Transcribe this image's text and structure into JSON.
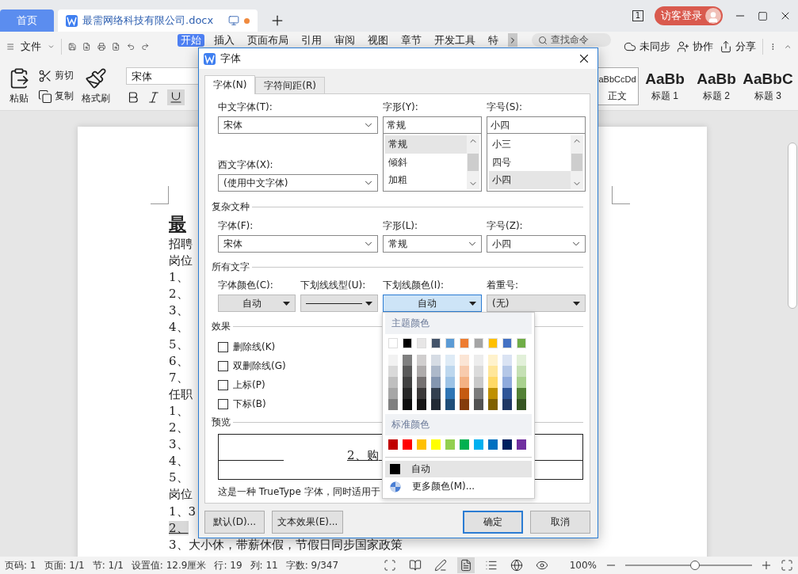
{
  "app_tabs": [
    {
      "label": "首页",
      "kind": "home",
      "selected": false
    },
    {
      "label": "最需网络科技有限公司.docx",
      "kind": "doc",
      "selected": true
    }
  ],
  "title_bar": {
    "page_badge": "1",
    "user_button": "访客登录"
  },
  "menu": {
    "file": "文件",
    "ribbon_tabs": [
      {
        "label": "开始",
        "selected": true
      },
      {
        "label": "插入",
        "selected": false
      },
      {
        "label": "页面布局",
        "selected": false
      },
      {
        "label": "引用",
        "selected": false
      },
      {
        "label": "审阅",
        "selected": false
      },
      {
        "label": "视图",
        "selected": false
      },
      {
        "label": "章节",
        "selected": false
      },
      {
        "label": "开发工具",
        "selected": false
      },
      {
        "label": "特",
        "selected": false
      }
    ],
    "search_placeholder": "查找命令",
    "actions": [
      {
        "label": "未同步",
        "kind": "sync"
      },
      {
        "label": "协作",
        "kind": "collab"
      },
      {
        "label": "分享",
        "kind": "share"
      }
    ]
  },
  "ribbon": {
    "paste": "粘贴",
    "cut": "剪切",
    "copy": "复制",
    "format_painter": "格式刷",
    "font_name": "宋体",
    "styles": [
      {
        "sample": "aBbCcDd",
        "name": "正文",
        "kind": "body",
        "selected": true
      },
      {
        "sample": "AaBb",
        "name": "标题 1",
        "kind": "heading",
        "selected": false
      },
      {
        "sample": "AaBb",
        "name": "标题 2",
        "kind": "heading",
        "selected": false
      },
      {
        "sample": "AaBbC",
        "name": "标题 3",
        "kind": "heading",
        "selected": false
      }
    ]
  },
  "document": {
    "heading": "最",
    "lines": [
      {
        "text": "招聘",
        "highlighted": false
      },
      {
        "text": "岗位",
        "highlighted": false
      },
      {
        "text": "1、",
        "highlighted": false
      },
      {
        "text": "2、",
        "highlighted": false
      },
      {
        "text": "3、",
        "highlighted": false
      },
      {
        "text": "4、",
        "highlighted": false
      },
      {
        "text": "5、",
        "highlighted": false
      },
      {
        "text": "6、",
        "highlighted": false
      },
      {
        "text": "7、",
        "highlighted": false
      },
      {
        "text": "任职",
        "highlighted": false
      },
      {
        "text": "1、",
        "highlighted": false
      },
      {
        "text": "2、",
        "highlighted": false
      },
      {
        "text": "3、",
        "highlighted": false
      },
      {
        "text": "4、",
        "highlighted": false
      },
      {
        "text": "5、",
        "highlighted": false
      },
      {
        "text": "岗位",
        "highlighted": false
      },
      {
        "text": "1、3",
        "highlighted": false
      },
      {
        "text": "2、",
        "highlighted": true
      },
      {
        "text": "3、大小休，带薪休假，节假日同步国家政策",
        "highlighted": false
      }
    ]
  },
  "dialog": {
    "title": "字体",
    "tabs": [
      {
        "label": "字体(N)",
        "selected": true
      },
      {
        "label": "字符间距(R)",
        "selected": false
      }
    ],
    "chinese_font": {
      "label": "中文字体(T):",
      "value": "宋体"
    },
    "western_font": {
      "label": "西文字体(X):",
      "value": "(使用中文字体)"
    },
    "style": {
      "label": "字形(Y):",
      "value": "常规",
      "options": [
        {
          "label": "常规",
          "selected": true
        },
        {
          "label": "倾斜",
          "selected": false
        },
        {
          "label": "加粗",
          "selected": false
        }
      ]
    },
    "size": {
      "label": "字号(S):",
      "value": "小四",
      "options": [
        {
          "label": "小三",
          "selected": false
        },
        {
          "label": "四号",
          "selected": false
        },
        {
          "label": "小四",
          "selected": true
        }
      ]
    },
    "complex_section": "复杂文种",
    "complex_fields": [
      {
        "label": "字体(F):",
        "value": "宋体"
      },
      {
        "label": "字形(L):",
        "value": "常规"
      },
      {
        "label": "字号(Z):",
        "value": "小四"
      }
    ],
    "all_text_section": "所有文字",
    "all_text_fields": [
      {
        "label": "字体颜色(C):",
        "kind": "color",
        "value": "自动",
        "open": false
      },
      {
        "label": "下划线线型(U):",
        "kind": "line",
        "open": false
      },
      {
        "label": "下划线颜色(I):",
        "kind": "color",
        "value": "自动",
        "open": true
      },
      {
        "label": "着重号:",
        "kind": "list",
        "value": "(无)",
        "open": false
      }
    ],
    "effects_section": "效果",
    "effects": [
      {
        "label": "删除线(K)",
        "checked": false
      },
      {
        "label": "双删除线(G)",
        "checked": false
      },
      {
        "label": "上标(P)",
        "checked": false
      },
      {
        "label": "下标(B)",
        "checked": false
      }
    ],
    "preview_section": "预览",
    "preview_text": "2、购",
    "note": "这是一种 TrueType 字体，同时适用于",
    "buttons": [
      {
        "label": "默认(D)...",
        "default": false
      },
      {
        "label": "文本效果(E)...",
        "default": false
      },
      {
        "label": "确定",
        "default": true
      },
      {
        "label": "取消",
        "default": false
      }
    ]
  },
  "color_menu": {
    "theme_title": "主题颜色",
    "theme_colors": [
      {
        "color": "#ffffff"
      },
      {
        "color": "#000000"
      },
      {
        "color": "#e7e6e6"
      },
      {
        "color": "#44546a"
      },
      {
        "color": "#5b9bd5"
      },
      {
        "color": "#ed7d31"
      },
      {
        "color": "#a5a5a5"
      },
      {
        "color": "#ffc000"
      },
      {
        "color": "#4472c4"
      },
      {
        "color": "#70ad47"
      }
    ],
    "shade_rows": [
      [
        {
          "color": "#f2f2f2"
        },
        {
          "color": "#7f7f7f"
        },
        {
          "color": "#d0cece"
        },
        {
          "color": "#d6dce4"
        },
        {
          "color": "#deebf6"
        },
        {
          "color": "#fbe5d5"
        },
        {
          "color": "#ededed"
        },
        {
          "color": "#fff2cc"
        },
        {
          "color": "#dae3f3"
        },
        {
          "color": "#e2f0d9"
        }
      ],
      [
        {
          "color": "#d9d9d9"
        },
        {
          "color": "#595959"
        },
        {
          "color": "#aeabab"
        },
        {
          "color": "#adb9ca"
        },
        {
          "color": "#bdd7ee"
        },
        {
          "color": "#f8cbad"
        },
        {
          "color": "#dbdbdb"
        },
        {
          "color": "#ffe699"
        },
        {
          "color": "#b4c7e7"
        },
        {
          "color": "#c5e0b4"
        }
      ],
      [
        {
          "color": "#bfbfbf"
        },
        {
          "color": "#404040"
        },
        {
          "color": "#757171"
        },
        {
          "color": "#8496b0"
        },
        {
          "color": "#9dc3e6"
        },
        {
          "color": "#f4b183"
        },
        {
          "color": "#c9c9c9"
        },
        {
          "color": "#ffd966"
        },
        {
          "color": "#8faadc"
        },
        {
          "color": "#a9d18e"
        }
      ],
      [
        {
          "color": "#a6a6a6"
        },
        {
          "color": "#262626"
        },
        {
          "color": "#3b3838"
        },
        {
          "color": "#333f4f"
        },
        {
          "color": "#2e75b5"
        },
        {
          "color": "#c55a11"
        },
        {
          "color": "#7b7b7b"
        },
        {
          "color": "#bf9000"
        },
        {
          "color": "#2f5597"
        },
        {
          "color": "#538135"
        }
      ],
      [
        {
          "color": "#808080"
        },
        {
          "color": "#0d0d0d"
        },
        {
          "color": "#171616"
        },
        {
          "color": "#222a35"
        },
        {
          "color": "#1f4e79"
        },
        {
          "color": "#843c0b"
        },
        {
          "color": "#525252"
        },
        {
          "color": "#7f6000"
        },
        {
          "color": "#203864"
        },
        {
          "color": "#375623"
        }
      ]
    ],
    "standard_title": "标准颜色",
    "standard_colors": [
      {
        "color": "#c00000"
      },
      {
        "color": "#ff0000"
      },
      {
        "color": "#ffc000"
      },
      {
        "color": "#ffff00"
      },
      {
        "color": "#92d050"
      },
      {
        "color": "#00b050"
      },
      {
        "color": "#00b0f0"
      },
      {
        "color": "#0070c0"
      },
      {
        "color": "#002060"
      },
      {
        "color": "#7030a0"
      }
    ],
    "items": [
      {
        "label": "自动",
        "kind": "auto",
        "selected": true
      },
      {
        "label": "更多颜色(M)...",
        "kind": "more",
        "selected": false
      }
    ]
  },
  "status_bar": {
    "items": [
      "页码: 1",
      "页面: 1/1",
      "节: 1/1",
      "设置值: 12.9厘米",
      "行: 19",
      "列: 11",
      "字数: 9/347"
    ],
    "view_modes": [
      {
        "kind": "fullscreen",
        "selected": false
      },
      {
        "kind": "reading",
        "selected": false
      },
      {
        "kind": "write",
        "selected": false
      },
      {
        "kind": "page",
        "selected": true
      },
      {
        "kind": "outline",
        "selected": false
      },
      {
        "kind": "web",
        "selected": false
      },
      {
        "kind": "eye",
        "selected": false
      }
    ],
    "zoom": "100%",
    "zoom_slider": {
      "level": 0.55
    }
  }
}
